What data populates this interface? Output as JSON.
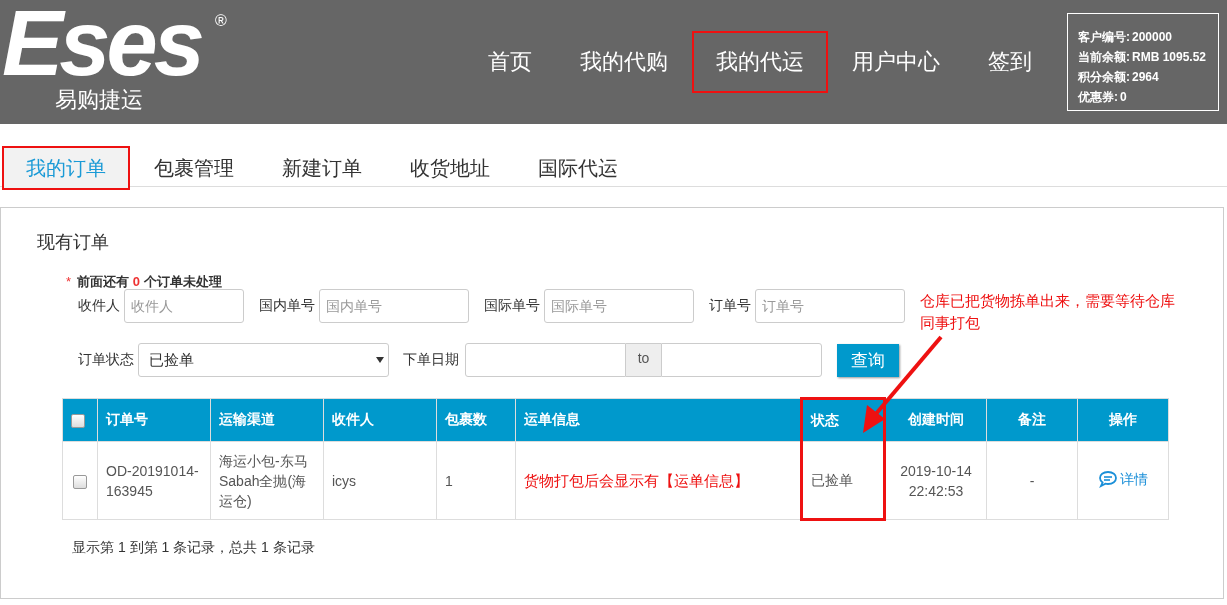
{
  "logo": {
    "wordmark": "Eses",
    "registered": "®",
    "subtitle": "易购捷运"
  },
  "nav": [
    {
      "label": "首页",
      "highlighted": false
    },
    {
      "label": "我的代购",
      "highlighted": false
    },
    {
      "label": "我的代运",
      "highlighted": true
    },
    {
      "label": "用户中心",
      "highlighted": false
    },
    {
      "label": "签到",
      "highlighted": false
    }
  ],
  "account": [
    {
      "label": "客户编号:",
      "value": "200000"
    },
    {
      "label": "当前余额:",
      "value": "RMB 1095.52"
    },
    {
      "label": "积分余额:",
      "value": "2964"
    },
    {
      "label": "优惠券:",
      "value": "0"
    }
  ],
  "tabs": [
    {
      "label": "我的订单",
      "selected": true,
      "highlighted": true
    },
    {
      "label": "包裹管理",
      "selected": false,
      "highlighted": false
    },
    {
      "label": "新建订单",
      "selected": false,
      "highlighted": false
    },
    {
      "label": "收货地址",
      "selected": false,
      "highlighted": false
    },
    {
      "label": "国际代运",
      "selected": false,
      "highlighted": false
    }
  ],
  "panel": {
    "title": "现有订单",
    "notice": {
      "mark": "*",
      "before": "前面还有",
      "count": "0",
      "after": "个订单未处理"
    },
    "filters": [
      {
        "label": "收件人",
        "placeholder": "收件人"
      },
      {
        "label": "国内单号",
        "placeholder": "国内单号"
      },
      {
        "label": "国际单号",
        "placeholder": "国际单号"
      },
      {
        "label": "订单号",
        "placeholder": "订单号"
      }
    ],
    "status_filter": {
      "label": "订单状态",
      "value": "已捡单"
    },
    "date_filter": {
      "label": "下单日期",
      "separator": "to"
    },
    "search_button": "查询",
    "annotation": "仓库已把货物拣单出来，需要等待仓库同事打包",
    "table": {
      "header_checked": false,
      "columns": [
        {
          "label": "订单号",
          "highlighted": false
        },
        {
          "label": "运输渠道",
          "highlighted": false
        },
        {
          "label": "收件人",
          "highlighted": false
        },
        {
          "label": "包裹数",
          "highlighted": false
        },
        {
          "label": "运单信息",
          "highlighted": false
        },
        {
          "label": "状态",
          "highlighted": true
        },
        {
          "label": "创建时间",
          "highlighted": false
        },
        {
          "label": "备注",
          "highlighted": false
        },
        {
          "label": "操作",
          "highlighted": false
        }
      ],
      "rows": [
        {
          "checked": false,
          "cells": [
            {
              "kind": "text",
              "text": "OD-20191014-163945"
            },
            {
              "kind": "text",
              "text": "海运小包-东马Sabah全抛(海运仓)"
            },
            {
              "kind": "text",
              "text": "icys"
            },
            {
              "kind": "text",
              "text": "1"
            },
            {
              "kind": "note",
              "text": "货物打包后会显示有【运单信息】"
            },
            {
              "kind": "text",
              "text": "已捡单"
            },
            {
              "kind": "text",
              "text": "2019-10-14 22:42:53"
            },
            {
              "kind": "text",
              "text": "-"
            },
            {
              "kind": "action",
              "text": "详情"
            }
          ]
        }
      ]
    },
    "footer": "显示第 1 到第 1 条记录，总共 1 条记录"
  }
}
